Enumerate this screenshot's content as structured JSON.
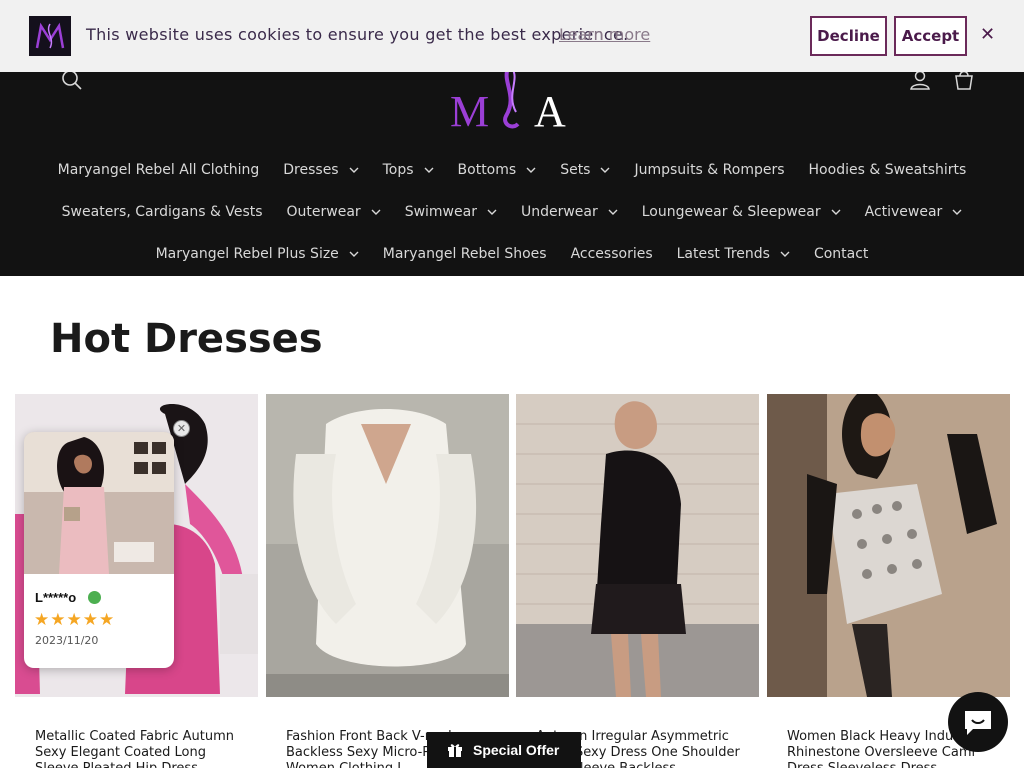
{
  "cookie_banner": {
    "message": "This website uses cookies to ensure you get the best experience.",
    "learn_more": "Learn more",
    "decline_label": "Decline",
    "accept_label": "Accept",
    "close_glyph": "✕",
    "logo_icon": "brand-logo-icon"
  },
  "header": {
    "logo_text": "MA",
    "icons": [
      "search-icon",
      "account-icon",
      "cart-icon"
    ],
    "nav_row_1": [
      "Maryangel Rebel All Clothing",
      "Dresses",
      "Tops",
      "Bottoms",
      "Sets",
      "Jumpsuits & Rompers",
      "Hoodies & Sweatshirts"
    ],
    "nav_row_2": [
      "Sweaters, Cardigans & Vests",
      "Outerwear",
      "Swimwear",
      "Underwear",
      "Loungewear & Sleepwear",
      "Activewear"
    ],
    "nav_row_3": [
      "Maryangel Rebel Plus Size",
      "Maryangel Rebel Shoes",
      "Accessories",
      "Latest Trends",
      "Contact"
    ],
    "has_dropdown": {
      "Dresses": true,
      "Tops": true,
      "Bottoms": true,
      "Sets": true,
      "Outerwear": true,
      "Swimwear": true,
      "Underwear": true,
      "Loungewear & Sleepwear": true,
      "Activewear": true,
      "Maryangel Rebel Plus Size": true,
      "Latest Trends": true
    }
  },
  "main": {
    "title": "Hot Dresses",
    "products": [
      {
        "title": "Metallic Coated Fabric Autumn Sexy Elegant Coated Long Sleeve Pleated Hip Dress"
      },
      {
        "title": "Fashion Front Back V-neck Backless Sexy Micro-Pull Dress Women Clothing L"
      },
      {
        "title": "Autumn Irregular Asymmetric Short Sexy Dress One Shoulder Long Sleeve Backless"
      },
      {
        "title": "Women Black Heavy Industry Rhinestone Oversleeve Cami Dress Sleeveless Dress Dopamine"
      }
    ]
  },
  "review_popup": {
    "name": "L*****o",
    "stars": "★★★★★",
    "rating": 5,
    "date": "2023/11/20",
    "close_glyph": "✕"
  },
  "special_offer": {
    "label": "Special Offer",
    "icon": "gift-icon"
  },
  "chat": {
    "icon": "chat-icon"
  },
  "colors": {
    "header_bg": "#121212",
    "accent": "#6b2a5a",
    "logo_purple": "#9b3fd6"
  }
}
